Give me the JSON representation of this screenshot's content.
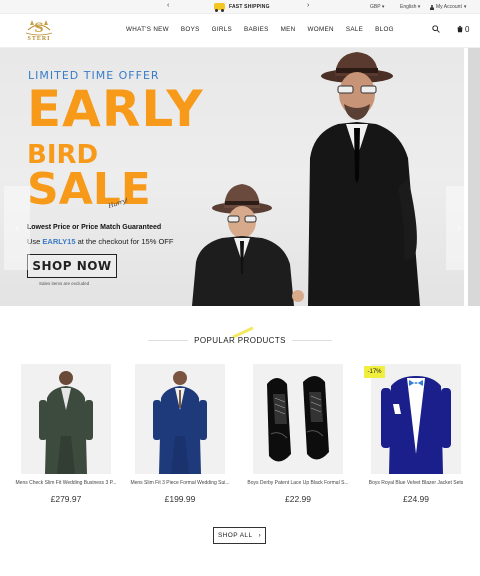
{
  "topbar": {
    "prev_icon": "chevron-left-icon",
    "next_icon": "chevron-right-icon",
    "shipping_icon": "truck-icon",
    "shipping_text": "FAST SHIPPING",
    "currency": "GBP",
    "language": "English",
    "account": "My Account"
  },
  "header": {
    "logo_text": "STERI",
    "nav": [
      "WHAT'S NEW",
      "BOYS",
      "GIRLS",
      "BABIES",
      "MEN",
      "WOMEN",
      "SALE",
      "BLOG"
    ],
    "search_icon": "search-icon",
    "cart_icon": "cart-icon",
    "cart_count": "0"
  },
  "hero": {
    "offer": "LIMITED TIME OFFER",
    "line1": "EARLY",
    "line2": "BIRD",
    "line3": "SALE",
    "signature": "Hurry!",
    "guarantee": "Lowest Price or Price Match Guaranteed",
    "code_pre": "Use ",
    "code": "EARLY15",
    "code_post": " at the checkout for 15% OFF",
    "button": "SHOP NOW",
    "note": "Sales items are excluded",
    "colors": {
      "accent": "#f79a1a",
      "blue": "#3a7cc7"
    }
  },
  "popular": {
    "title": "POPULAR PRODUCTS",
    "products": [
      {
        "name": "Mens Check Slim Fit Wedding Business 3 P...",
        "price": "£279.97"
      },
      {
        "name": "Mens Slim Fit 3 Piece Formal Wedding Sui...",
        "price": "£199.99"
      },
      {
        "name": "Boys Derby Patent Lace Up Black Formal S...",
        "price": "£22.99"
      },
      {
        "name": "Boys Royal Blue Velvet Blazer Jacket Sets",
        "price": "£24.99"
      }
    ],
    "badge": "-17%",
    "shop_all": "SHOP ALL"
  }
}
